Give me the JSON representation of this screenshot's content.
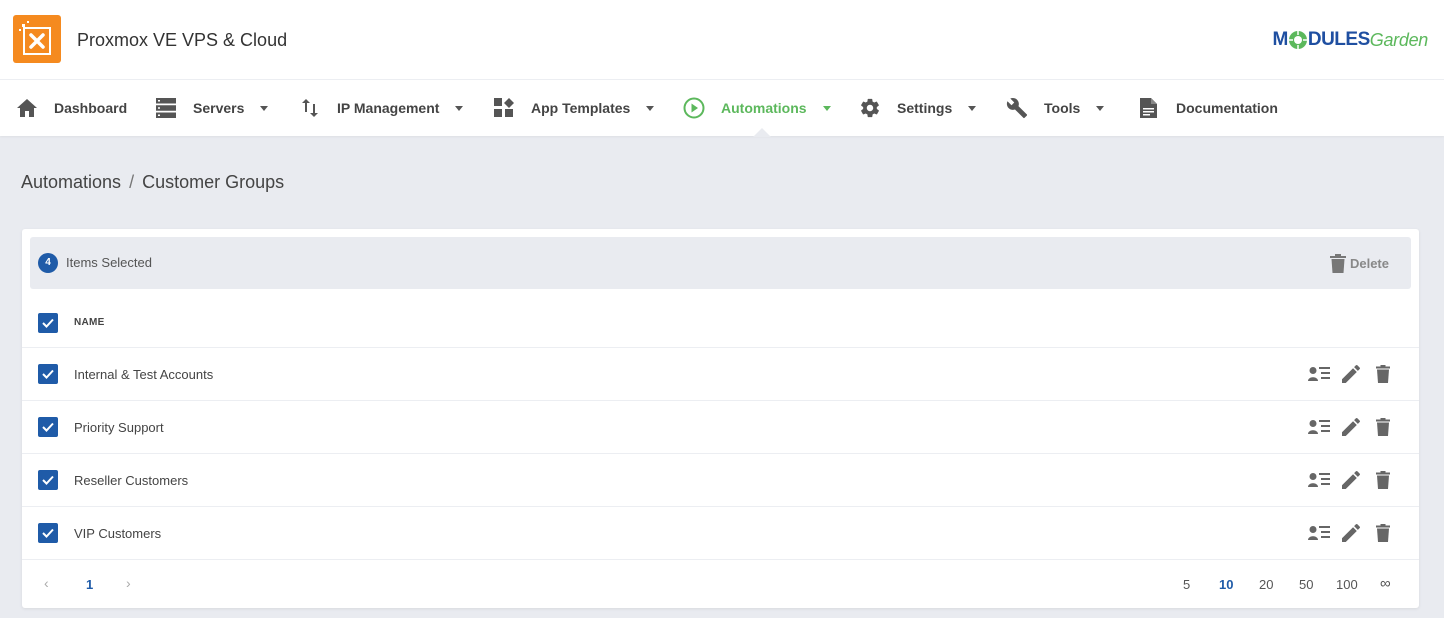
{
  "header": {
    "app_title": "Proxmox VE VPS & Cloud",
    "brand_part1": "M",
    "brand_part2": "DULES",
    "brand_part3": "Garden",
    "logo_icon": "modulesgarden-box-icon",
    "accent_color": "#f58a1f"
  },
  "nav": {
    "items": [
      {
        "label": "Dashboard",
        "icon": "home-icon",
        "dropdown": false
      },
      {
        "label": "Servers",
        "icon": "servers-icon",
        "dropdown": true
      },
      {
        "label": "IP Management",
        "icon": "sort-arrows-icon",
        "dropdown": true
      },
      {
        "label": "App Templates",
        "icon": "widgets-icon",
        "dropdown": true
      },
      {
        "label": "Automations",
        "icon": "play-circle-icon",
        "dropdown": true,
        "active": true
      },
      {
        "label": "Settings",
        "icon": "gear-icon",
        "dropdown": true
      },
      {
        "label": "Tools",
        "icon": "wrench-icon",
        "dropdown": true
      },
      {
        "label": "Documentation",
        "icon": "document-icon",
        "dropdown": false
      }
    ],
    "active_color": "#5cb85c"
  },
  "breadcrumb": {
    "parent": "Automations",
    "separator": "/",
    "current": "Customer Groups"
  },
  "selection": {
    "count": "4",
    "label": "Items Selected",
    "delete_label": "Delete"
  },
  "table": {
    "column_name": "NAME",
    "rows": [
      {
        "name": "Internal & Test Accounts",
        "checked": true
      },
      {
        "name": "Priority Support",
        "checked": true
      },
      {
        "name": "Reseller Customers",
        "checked": true
      },
      {
        "name": "VIP Customers",
        "checked": true
      }
    ]
  },
  "pagination": {
    "current_page": "1",
    "prev": "‹",
    "next": "›",
    "page_sizes": [
      "5",
      "10",
      "20",
      "50",
      "100",
      "∞"
    ],
    "active_size": "10"
  },
  "colors": {
    "primary": "#1f5ba8",
    "background": "#e9ebf0"
  }
}
